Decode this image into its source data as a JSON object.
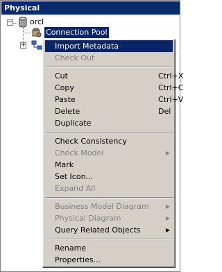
{
  "window": {
    "title": "Physical"
  },
  "tree": {
    "root_label": "orcl",
    "selected_label": "Connection Pool"
  },
  "context_menu": {
    "items": [
      {
        "label": "Import Metadata",
        "shortcut": "",
        "enabled": true,
        "highlighted": true,
        "submenu": false
      },
      {
        "label": "Check Out",
        "shortcut": "",
        "enabled": false,
        "submenu": false
      },
      {
        "label": "Cut",
        "shortcut": "Ctrl+X",
        "enabled": true,
        "submenu": false
      },
      {
        "label": "Copy",
        "shortcut": "Ctrl+C",
        "enabled": true,
        "submenu": false
      },
      {
        "label": "Paste",
        "shortcut": "Ctrl+V",
        "enabled": true,
        "submenu": false
      },
      {
        "label": "Delete",
        "shortcut": "Del",
        "enabled": true,
        "submenu": false
      },
      {
        "label": "Duplicate",
        "shortcut": "",
        "enabled": true,
        "submenu": false
      },
      {
        "label": "Check Consistency",
        "shortcut": "",
        "enabled": true,
        "submenu": false
      },
      {
        "label": "Check Model",
        "shortcut": "",
        "enabled": false,
        "submenu": true
      },
      {
        "label": "Mark",
        "shortcut": "",
        "enabled": true,
        "submenu": false
      },
      {
        "label": "Set Icon...",
        "shortcut": "",
        "enabled": true,
        "submenu": false
      },
      {
        "label": "Expand All",
        "shortcut": "",
        "enabled": false,
        "submenu": false
      },
      {
        "label": "Business Model Diagram",
        "shortcut": "",
        "enabled": false,
        "submenu": true
      },
      {
        "label": "Physical Diagram",
        "shortcut": "",
        "enabled": false,
        "submenu": true
      },
      {
        "label": "Query Related Objects",
        "shortcut": "",
        "enabled": true,
        "submenu": true
      },
      {
        "label": "Rename",
        "shortcut": "",
        "enabled": true,
        "submenu": false
      },
      {
        "label": "Properties...",
        "shortcut": "",
        "enabled": true,
        "submenu": false
      }
    ]
  },
  "colors": {
    "title_bg": "#0a2a6e",
    "highlight": "#0a246a",
    "menu_bg": "#d4d0c8",
    "disabled_text": "#808080"
  }
}
